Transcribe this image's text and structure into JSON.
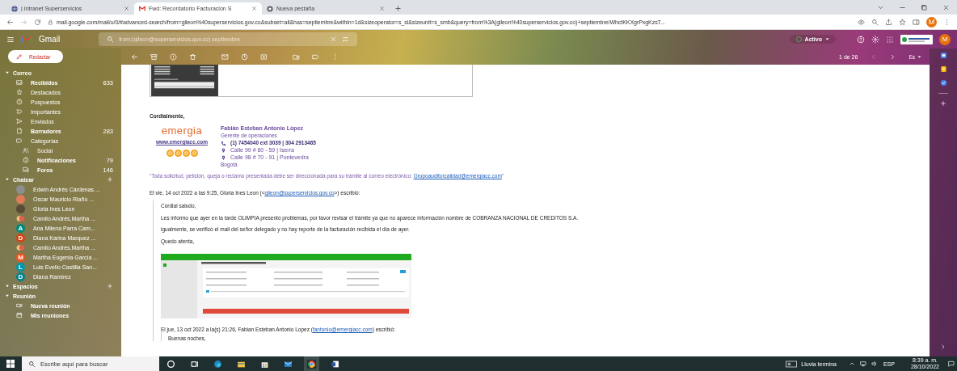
{
  "browser": {
    "tabs": [
      {
        "title": "| Intranet Superservicios",
        "kind": "site",
        "selected": false
      },
      {
        "title": "Fwd: Recordatorio Facturación S",
        "kind": "gmail",
        "selected": true
      },
      {
        "title": "Nueva pestaña",
        "kind": "newtab",
        "selected": false
      }
    ],
    "url": "mail.google.com/mail/u/0/#advanced-search/from=gileon%40superservicios.gov.co&subset=all&has=septiembre&within=1d&sizeoperator=s_sl&sizeunit=s_smb&query=from%3A(gileon%40superservicios.gov.co)+septiembre/WhctKKXgrPxgKzsT...",
    "profile_initial": "M"
  },
  "gmail": {
    "app_name": "Gmail",
    "search": {
      "value": "from:(gileon@superservicios.gov.co) septiembre"
    },
    "status": "Activo",
    "account_initial": "M",
    "compose": "Redactar",
    "pagination": "1 de 26",
    "language": "Es"
  },
  "sidebar": {
    "mail_heading": "Correo",
    "folders": [
      {
        "label": "Recibidos",
        "count": "633",
        "kind": "inbox",
        "bold": true
      },
      {
        "label": "Destacados",
        "kind": "star",
        "bold": false
      },
      {
        "label": "Pospuestos",
        "kind": "snoozed",
        "bold": false
      },
      {
        "label": "Importantes",
        "kind": "important",
        "bold": false
      },
      {
        "label": "Enviados",
        "kind": "sent",
        "bold": false
      },
      {
        "label": "Borradores",
        "count": "283",
        "kind": "drafts",
        "bold": true
      },
      {
        "label": "Categorías",
        "kind": "categories",
        "bold": false,
        "children": [
          {
            "label": "Social",
            "kind": "social",
            "bold": false
          },
          {
            "label": "Notificaciones",
            "count": "79",
            "kind": "updates",
            "bold": true
          },
          {
            "label": "Foros",
            "count": "146",
            "kind": "forums",
            "bold": true
          }
        ]
      }
    ],
    "chat_heading": "Chatear",
    "contacts": [
      {
        "name": "Edwin Andrés Cárdenas ...",
        "kind": "photo",
        "color": "#8d8d8d"
      },
      {
        "name": "Oscar Mauricio Riaño ...",
        "kind": "photo",
        "color": "#e07b5a"
      },
      {
        "name": "Gloria Ines Leon",
        "kind": "photo",
        "color": "#5a4a3a"
      },
      {
        "name": "Camilo Andrés,Martha ...",
        "kind": "group",
        "color": "#e0604a"
      },
      {
        "name": "Ana Milena Parra Cam...",
        "kind": "letter",
        "letter": "A",
        "color": "#00897b"
      },
      {
        "name": "Diana Karina Marquez ...",
        "kind": "letter",
        "letter": "D",
        "color": "#d84315"
      },
      {
        "name": "Camilo Andrés,Martha ...",
        "kind": "group",
        "color": "#e0604a"
      },
      {
        "name": "Martha Eugenia García ...",
        "kind": "letter",
        "letter": "M",
        "color": "#f4511e"
      },
      {
        "name": "Luis Evelio Castilla San...",
        "kind": "letter",
        "letter": "L",
        "color": "#0097a7"
      },
      {
        "name": "Diana Ramírez",
        "kind": "letter",
        "letter": "D",
        "color": "#00838f"
      }
    ],
    "spaces_heading": "Espacios",
    "meet_heading": "Reunión",
    "meet_items": [
      {
        "label": "Nueva reunión",
        "kind": "video"
      },
      {
        "label": "Mis reuniones",
        "kind": "calendar"
      }
    ]
  },
  "message": {
    "closing": "Cordialmente,",
    "signature": {
      "logo": "emergia",
      "website": "www.emergiacc.com",
      "name": "Fabián Esteban Antonio López",
      "role": "Gerente de operaciones",
      "phone": "(1) 7454040 ext 3039 | 304 2913465",
      "addresses": [
        "Calle 99 # 60 - 59 | Iserra",
        "Calle 98 # 70 - 91 | Pontevedra"
      ],
      "city": "Bogotá"
    },
    "notice": "“Toda solicitud, petición, queja o reclamo presentada debe ser direccionada para su trámite al correo electrónico: ",
    "notice_link": "Grupoauditorcalidad@emergiacc.com",
    "notice_end": "”",
    "quote_header": {
      "before": "El vie, 14 oct 2022 a las 9:25, Gloria Ines Leon (<",
      "link": "gileon@superservicios.gov.co",
      "after": ">) escribió:"
    },
    "quoted_paragraphs": [
      "Cordial saludo,",
      "Les informo que ayer en la tarde OLIMPIA presentó problemas, por favor revisar el trámite ya que no aparece información nombre de COBRANZA NACIONAL DE CREDITOS  S.A.",
      "igualmente, se verificó el mail del señor delegado y no hay reporte de la facturación recibida el día de ayer.",
      "Quedo atenta,"
    ],
    "inner_header": {
      "before": "El jue, 13 oct 2022 a la(s) 21:26, Fabian Esteban Antonio Lopez (",
      "link": "fantonio@emergiacc.com",
      "after": ") escribió:"
    },
    "inner_first_line": "Buenas noches,"
  },
  "taskbar": {
    "search_placeholder": "Escribe aquí para buscar",
    "weather": "Lluvia termina",
    "language": "ESP",
    "time": "8:39 a. m.",
    "date": "28/10/2022"
  }
}
